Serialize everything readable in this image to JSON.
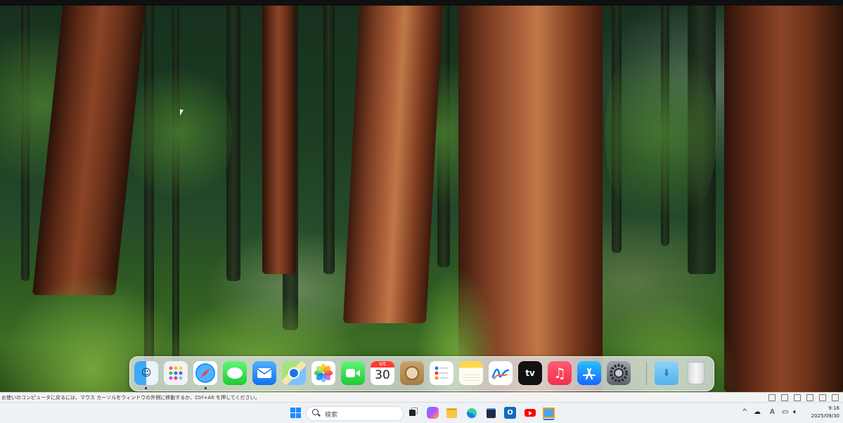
{
  "desktop": {
    "wallpaper": "forest-sequoia-wallpaper",
    "cursor": "arrow-cursor-icon"
  },
  "dock": {
    "apps": [
      {
        "name": "Finder",
        "icon": "finder-icon",
        "running": true
      },
      {
        "name": "Launchpad",
        "icon": "launchpad-icon",
        "running": false
      },
      {
        "name": "Safari",
        "icon": "safari-icon",
        "running": true
      },
      {
        "name": "Messages",
        "icon": "messages-icon",
        "running": false
      },
      {
        "name": "Mail",
        "icon": "mail-icon",
        "running": false
      },
      {
        "name": "Maps",
        "icon": "maps-icon",
        "running": false
      },
      {
        "name": "Photos",
        "icon": "photos-icon",
        "running": false
      },
      {
        "name": "FaceTime",
        "icon": "facetime-icon",
        "running": false
      },
      {
        "name": "Calendar",
        "icon": "calendar-icon",
        "running": false
      },
      {
        "name": "Contacts",
        "icon": "contacts-icon",
        "running": false
      },
      {
        "name": "Reminders",
        "icon": "reminders-icon",
        "running": false
      },
      {
        "name": "Notes",
        "icon": "notes-icon",
        "running": false
      },
      {
        "name": "Freeform",
        "icon": "freeform-icon",
        "running": false
      },
      {
        "name": "TV",
        "icon": "apple-tv-icon",
        "running": false
      },
      {
        "name": "Music",
        "icon": "music-icon",
        "running": false
      },
      {
        "name": "App Store",
        "icon": "app-store-icon",
        "running": false
      },
      {
        "name": "System Settings",
        "icon": "system-settings-icon",
        "running": false
      },
      {
        "name": "Downloads",
        "icon": "downloads-folder-icon",
        "running": false
      },
      {
        "name": "Trash",
        "icon": "trash-icon",
        "running": false
      }
    ],
    "calendar": {
      "month": "9月",
      "day": "30"
    },
    "tv_label": "tv"
  },
  "hint_bar": {
    "text": "お使いのコンピュータに戻るには、マウス カーソルをウィンドウの外側に移動するか、Ctrl+Alt を押してください。"
  },
  "taskbar": {
    "search_placeholder": "検索",
    "pinned": [
      "windows-start-icon",
      "search-icon",
      "task-view-icon",
      "copilot-icon",
      "file-explorer-icon",
      "edge-icon",
      "store-icon",
      "outlook-icon",
      "youtube-icon",
      "remote-desktop-icon"
    ],
    "tray": {
      "chevron": "^",
      "ime": "A",
      "time": "9:16",
      "date": "2025/09/30"
    }
  },
  "colors": {
    "dock_bg": "#e1e6e8",
    "taskbar_bg": "#eef1f6",
    "hint_bg": "#f3f3f3"
  }
}
